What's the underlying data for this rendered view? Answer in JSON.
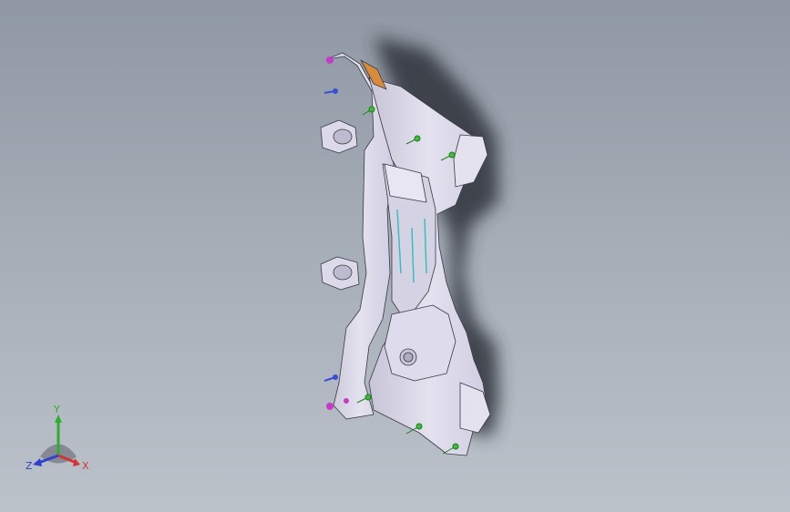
{
  "viewport": {
    "background_top": "#8f98a3",
    "background_bottom": "#bcc2ca"
  },
  "model": {
    "body_color": "#d9d7e6",
    "edge_color": "#3a3a46",
    "shadow_color": "#2e333a",
    "accent_colors": [
      "#3bbf3b",
      "#3a4fd6",
      "#c63bc6",
      "#d98a3a",
      "#2bbfbf"
    ]
  },
  "triad": {
    "x_label": "X",
    "y_label": "Y",
    "z_label": "Z",
    "x_color": "#d63333",
    "y_color": "#2eae2e",
    "z_color": "#2f3fd1"
  }
}
